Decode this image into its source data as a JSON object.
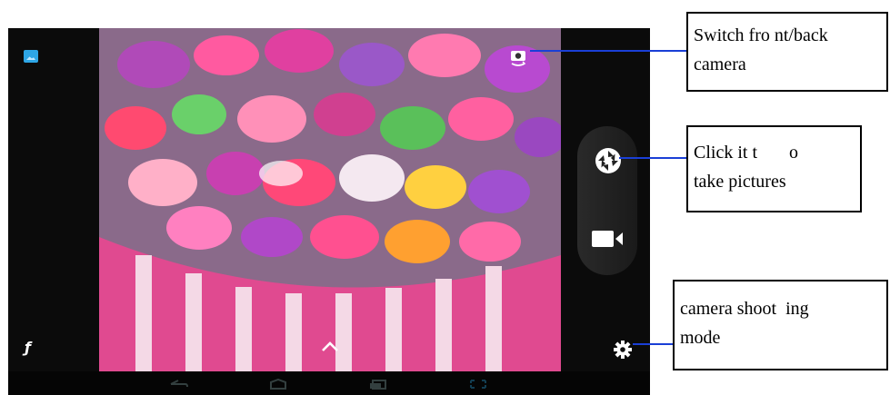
{
  "annotations": {
    "switch_camera": "Switch fro nt/back\ncamera",
    "take_picture": "Click it t       o\ntake pictures",
    "shooting_mode": "camera shoot  ing\nmode"
  },
  "camera_ui": {
    "gallery_icon": "gallery-thumbnail-icon",
    "flash_icon": "flash-icon",
    "switch_icon": "switch-camera-icon",
    "shutter_icon": "shutter-icon",
    "video_icon": "video-camera-icon",
    "expand_icon": "chevron-up-icon",
    "settings_icon": "gear-icon",
    "flash_glyph": "ƒ",
    "nav_icons": [
      "back-icon",
      "home-icon",
      "recents-icon",
      "screenshot-icon"
    ]
  },
  "colors": {
    "leader_line": "#1a3fd6",
    "gallery_accent": "#2ea6e6"
  }
}
